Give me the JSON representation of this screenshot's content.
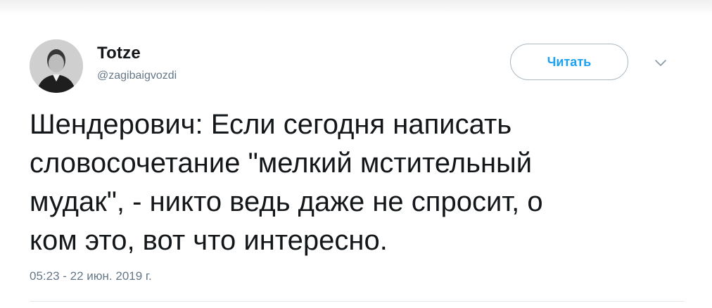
{
  "tweet": {
    "author": {
      "display_name": "Totze",
      "handle": "@zagibaigvozdi",
      "avatar_icon": "user-photo-icon"
    },
    "follow_label": "Читать",
    "menu_icon": "chevron-down-icon",
    "text": "Шендерович: Если сегодня написать\nсловосочетание \"мелкий мстительный\nмудак\", - никто ведь даже не спросит, о\nком это, вот что интересно.",
    "timestamp": "05:23 - 22 июн. 2019 г."
  },
  "colors": {
    "accent": "#1da1f2",
    "text": "#14171a",
    "secondary_text": "#657786",
    "border": "#aab8c2"
  }
}
